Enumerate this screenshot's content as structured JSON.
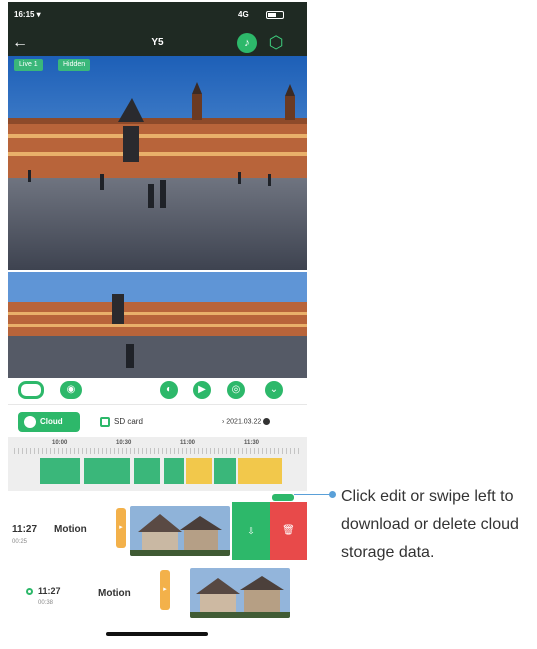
{
  "status_bar": {
    "time": "16:15 ▾",
    "network": "4G"
  },
  "app_bar": {
    "title": "Y5"
  },
  "video": {
    "chip_live": "Live 1",
    "chip_quality": "Hidden"
  },
  "tabs": {
    "cloud_label": "Cloud",
    "sd_label": "SD card",
    "date": "› 2021.03.22"
  },
  "timeline": {
    "labels": [
      "10:00",
      "10:30",
      "11:00",
      "11:30"
    ]
  },
  "events": [
    {
      "time": "11:27",
      "sub": "00:25",
      "type": "Motion"
    },
    {
      "time": "11:27",
      "sub": "00:38",
      "type": "Motion"
    }
  ],
  "swipe_actions": {
    "download_icon": "download-icon",
    "delete_icon": "trash-icon",
    "download_color": "#2db86a",
    "delete_color": "#e84a4a"
  },
  "callout": {
    "text": "Click edit or swipe left to download or delete cloud storage data."
  }
}
